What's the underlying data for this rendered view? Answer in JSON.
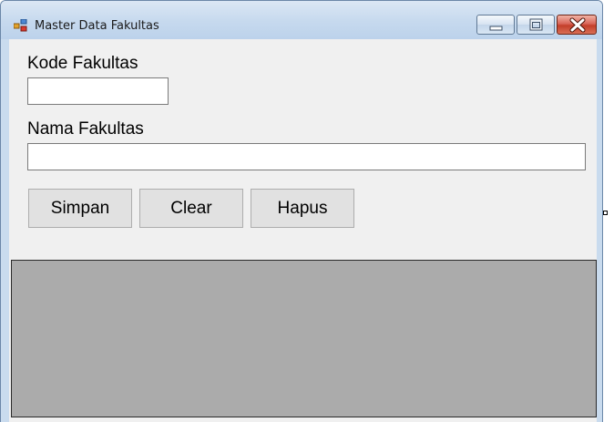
{
  "window": {
    "title": "Master Data Fakultas",
    "icon": "winforms-app-icon",
    "controls": {
      "minimize_icon": "minimize-icon",
      "maximize_icon": "maximize-icon",
      "close_icon": "close-icon"
    }
  },
  "form": {
    "kode_label": "Kode Fakultas",
    "kode_value": "",
    "nama_label": "Nama Fakultas",
    "nama_value": ""
  },
  "buttons": {
    "simpan": "Simpan",
    "clear": "Clear",
    "hapus": "Hapus"
  },
  "grid": {
    "rows": [],
    "background": "#ababab"
  },
  "colors": {
    "client_background": "#f0f0f0",
    "close_button": "#c94a36",
    "titlebar": "#c6d9ee"
  }
}
